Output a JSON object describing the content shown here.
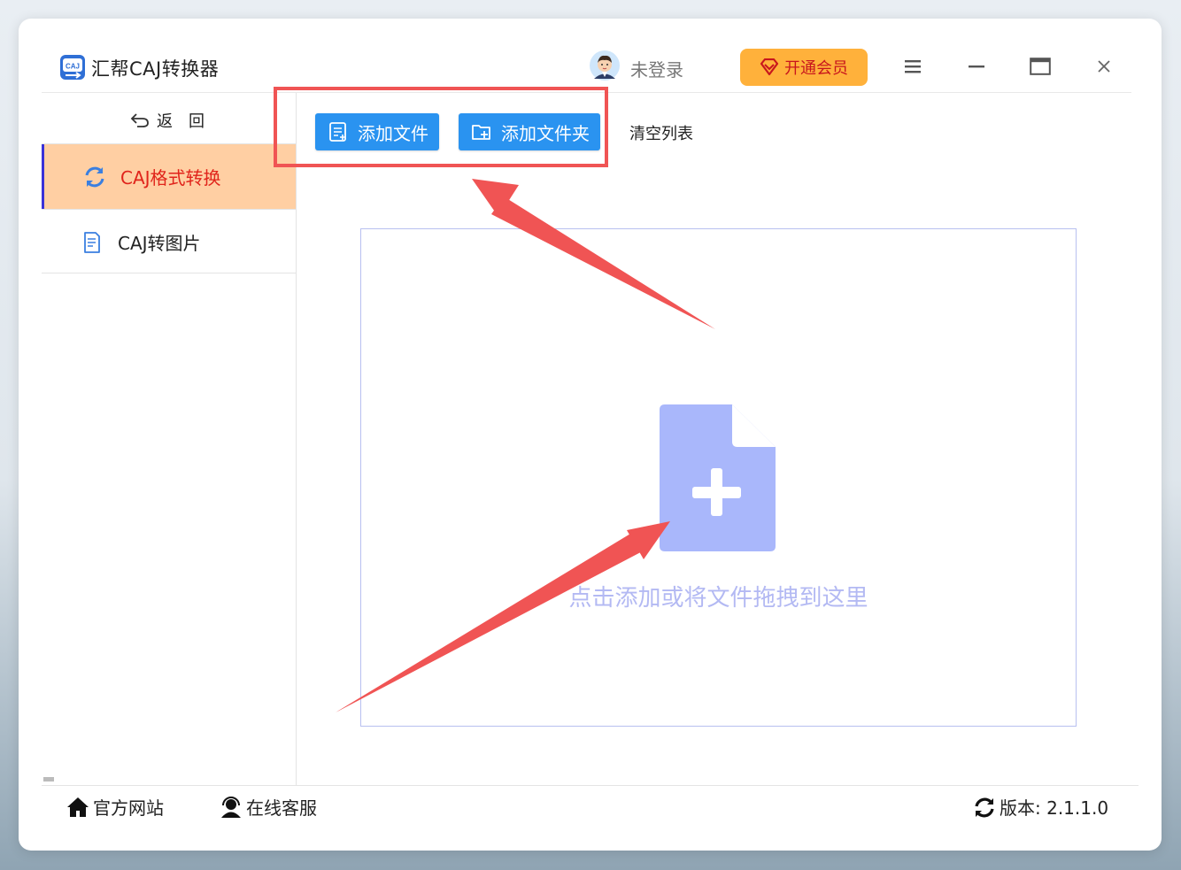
{
  "app": {
    "title": "汇帮CAJ转换器",
    "logo_text": "CAJ"
  },
  "header": {
    "login_text": "未登录",
    "vip_label": "开通会员"
  },
  "sidebar": {
    "back_label": "返　回",
    "items": [
      {
        "label": "CAJ格式转换",
        "active": true,
        "icon": "refresh-icon"
      },
      {
        "label": "CAJ转图片",
        "active": false,
        "icon": "document-icon"
      }
    ]
  },
  "toolbar": {
    "add_file_label": "添加文件",
    "add_folder_label": "添加文件夹",
    "clear_label": "清空列表"
  },
  "dropzone": {
    "hint": "点击添加或将文件拖拽到这里"
  },
  "footer": {
    "website_label": "官方网站",
    "support_label": "在线客服",
    "version_label": "版本: 2.1.1.0"
  },
  "colors": {
    "accent_blue": "#2a93f0",
    "vip_orange": "#ffb13b",
    "active_bg": "#ffcfa3",
    "active_text": "#e0241b",
    "annotation_red": "#f05454",
    "dropzone_icon": "#a9b7fb"
  }
}
